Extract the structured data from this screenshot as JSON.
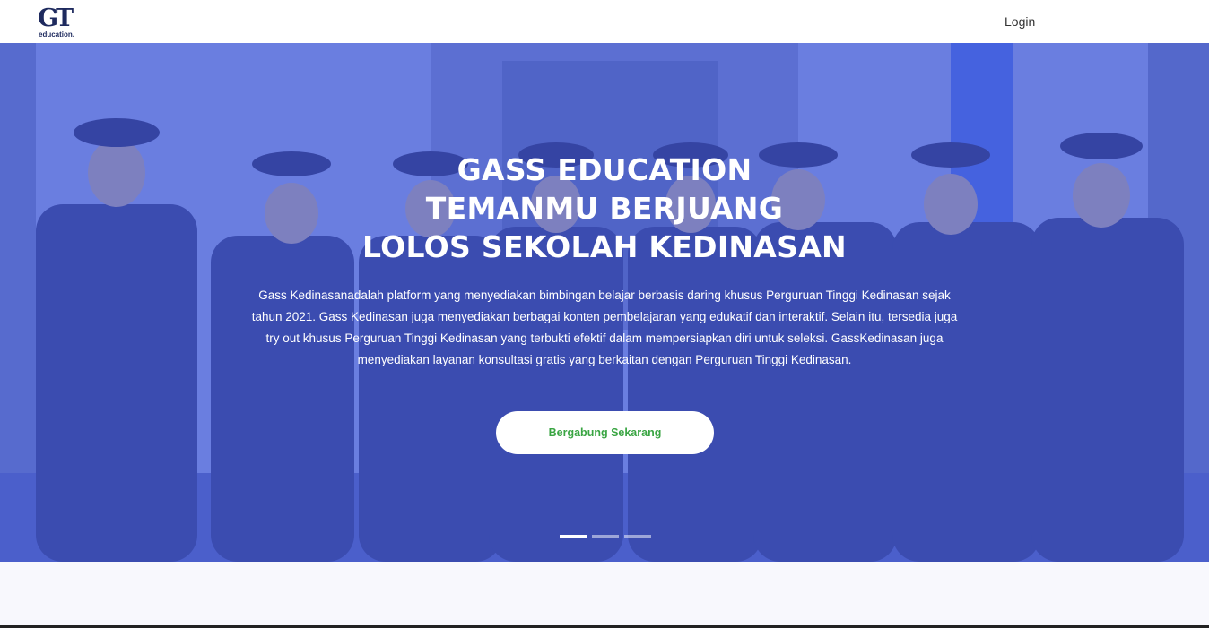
{
  "navbar": {
    "logo": {
      "mark": "GT",
      "subtext": "education."
    },
    "login_label": "Login"
  },
  "hero": {
    "title_lines": [
      "GASS EDUCATION",
      "TEMANMU BERJUANG",
      "LOLOS SEKOLAH KEDINASAN"
    ],
    "description": "Gass Kedinasanadalah platform yang menyediakan bimbingan belajar berbasis daring khusus Perguruan Tinggi Kedinasan sejak tahun 2021. Gass Kedinasan juga menyediakan berbagai konten pembelajaran yang edukatif dan interaktif. Selain itu, tersedia juga try out khusus Perguruan Tinggi Kedinasan yang terbukti efektif dalam mempersiapkan diri untuk seleksi. GassKedinasan juga menyediakan layanan konsultasi gratis yang berkaitan dengan Perguruan Tinggi Kedinasan.",
    "cta_label": "Bergabung Sekarang",
    "carousel": {
      "slides": 3,
      "active_index": 0
    }
  },
  "colors": {
    "overlay": "#4c62e8",
    "cta_text": "#3aa543",
    "logo": "#1e2a5e"
  }
}
